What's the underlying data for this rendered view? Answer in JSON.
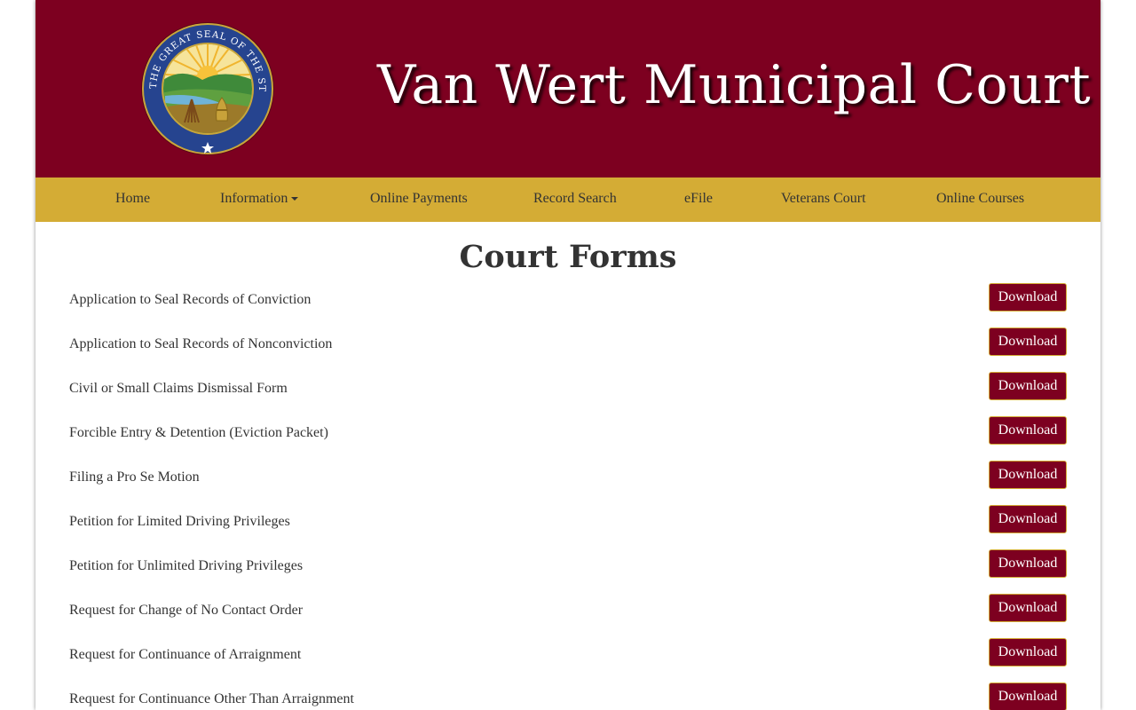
{
  "header": {
    "title": "Van Wert Municipal Court",
    "seal": {
      "icon": "state-of-ohio-seal",
      "text": "THE GREAT SEAL OF THE STATE OF OHIO"
    }
  },
  "nav": {
    "items": [
      {
        "label": "Home"
      },
      {
        "label": "Information",
        "dropdown": true
      },
      {
        "label": "Online Payments"
      },
      {
        "label": "Record Search"
      },
      {
        "label": "eFile"
      },
      {
        "label": "Veterans Court"
      },
      {
        "label": "Online Courses"
      }
    ]
  },
  "main": {
    "heading": "Court Forms",
    "forms": [
      {
        "name": "Application to Seal Records of Conviction",
        "button": "Download"
      },
      {
        "name": "Application to Seal Records of Nonconviction",
        "button": "Download"
      },
      {
        "name": "Civil or Small Claims Dismissal Form",
        "button": "Download"
      },
      {
        "name": "Forcible Entry & Detention (Eviction Packet)",
        "button": "Download"
      },
      {
        "name": "Filing a Pro Se Motion",
        "button": "Download"
      },
      {
        "name": "Petition for Limited Driving Privileges",
        "button": "Download"
      },
      {
        "name": "Petition for Unlimited Driving Privileges",
        "button": "Download"
      },
      {
        "name": "Request for Change of No Contact Order",
        "button": "Download"
      },
      {
        "name": "Request for Continuance of Arraignment",
        "button": "Download"
      },
      {
        "name": "Request for Continuance Other Than Arraignment",
        "button": "Download"
      }
    ]
  },
  "colors": {
    "banner": "#7d0020",
    "navbar": "#d4ac35",
    "button": "#7d0020",
    "text": "#333333"
  }
}
